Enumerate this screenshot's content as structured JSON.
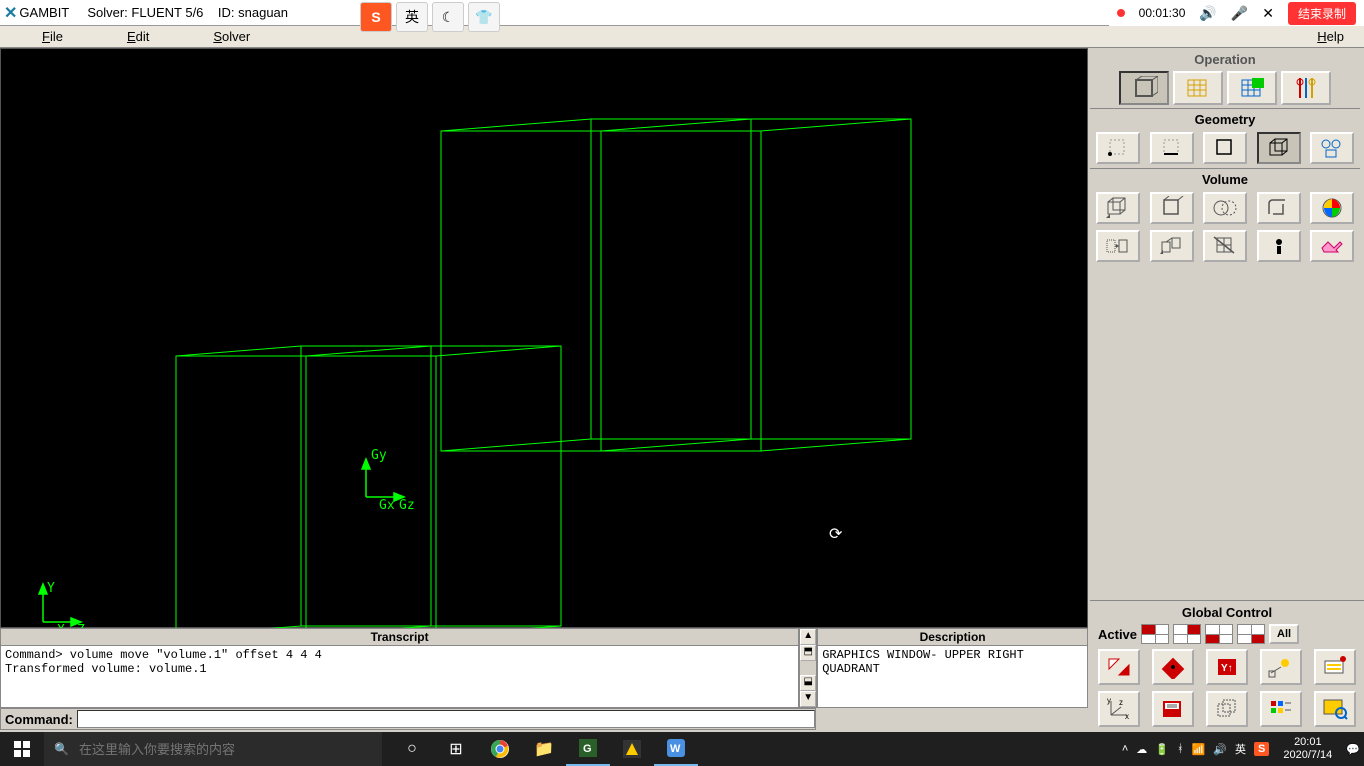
{
  "title": {
    "app": "GAMBIT",
    "solver_label": "Solver:",
    "solver": "FLUENT 5/6",
    "id_label": "ID:",
    "id": "snaguan"
  },
  "recording": {
    "time": "00:01:30",
    "stop_label": "结束录制"
  },
  "menu": {
    "file": "File",
    "edit": "Edit",
    "solver": "Solver",
    "help": "Help"
  },
  "floating": {
    "ying": "英"
  },
  "viewport": {
    "axis_y": "Y",
    "axis_x": "X",
    "axis_z": "Z",
    "gy": "Gy",
    "gx": "Gx",
    "gz": "Gz"
  },
  "panels": {
    "operation": "Operation",
    "geometry": "Geometry",
    "volume": "Volume",
    "global_control": "Global Control",
    "active": "Active",
    "all": "All",
    "transcript": "Transcript",
    "description": "Description",
    "command_label": "Command:"
  },
  "transcript": {
    "line1": "Command> volume move \"volume.1\" offset 4 4 4",
    "line2": "Transformed volume: volume.1"
  },
  "description": {
    "text": "GRAPHICS WINDOW- UPPER RIGHT QUADRANT"
  },
  "command_value": "",
  "taskbar": {
    "search_placeholder": "在这里输入你要搜索的内容",
    "ime": "英",
    "time": "20:01",
    "date": "2020/7/14"
  }
}
